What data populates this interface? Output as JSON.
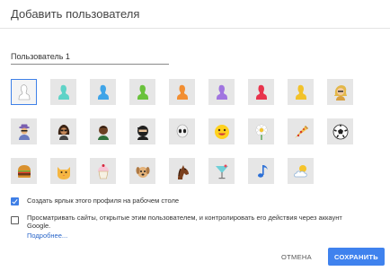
{
  "dialog": {
    "title": "Добавить пользователя"
  },
  "name_input": {
    "value": "Пользователь 1"
  },
  "avatars": [
    {
      "icon": "silhouette-white-icon",
      "color": "#ffffff",
      "selected": true
    },
    {
      "icon": "silhouette-teal-icon",
      "color": "#5fd3c7"
    },
    {
      "icon": "silhouette-blue-icon",
      "color": "#3fa4e8"
    },
    {
      "icon": "silhouette-green-icon",
      "color": "#6ac23c"
    },
    {
      "icon": "silhouette-orange-icon",
      "color": "#f28e32"
    },
    {
      "icon": "silhouette-purple-icon",
      "color": "#a175e0"
    },
    {
      "icon": "silhouette-red-icon",
      "color": "#e8344d"
    },
    {
      "icon": "silhouette-yellow-icon",
      "color": "#f2c22a"
    },
    {
      "icon": "blonde-person-icon"
    },
    {
      "icon": "detective-icon"
    },
    {
      "icon": "woman-sunglasses-icon"
    },
    {
      "icon": "man-icon"
    },
    {
      "icon": "ninja-icon"
    },
    {
      "icon": "alien-icon"
    },
    {
      "icon": "smiley-icon"
    },
    {
      "icon": "flower-icon"
    },
    {
      "icon": "pizza-icon"
    },
    {
      "icon": "soccer-ball-icon"
    },
    {
      "icon": "burger-icon"
    },
    {
      "icon": "cat-icon"
    },
    {
      "icon": "cupcake-icon"
    },
    {
      "icon": "dog-icon"
    },
    {
      "icon": "horse-icon"
    },
    {
      "icon": "cocktail-icon"
    },
    {
      "icon": "music-note-icon"
    },
    {
      "icon": "sun-cloud-icon"
    }
  ],
  "options": {
    "shortcut": {
      "label": "Создать ярлык этого профиля на рабочем столе",
      "checked": true
    },
    "supervise": {
      "label": "Просматривать сайты, открытые этим пользователем, и контролировать его действия через аккаунт Google.",
      "checked": false
    },
    "more_link": "Подробнее..."
  },
  "buttons": {
    "cancel": "ОТМЕНА",
    "save": "СОХРАНИТЬ"
  },
  "colors": {
    "accent": "#3f82ee",
    "link": "#2a66c9"
  }
}
